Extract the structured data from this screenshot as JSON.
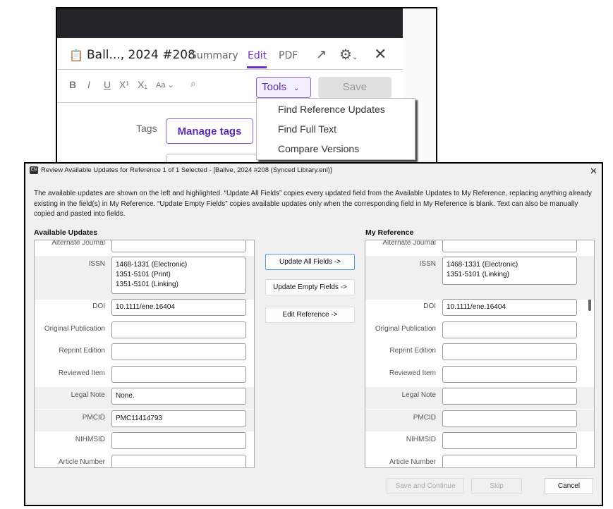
{
  "editor": {
    "title": "Ball..., 2024 #208",
    "tabs": [
      "Summary",
      "Edit",
      "PDF"
    ],
    "toolbar": [
      "B",
      "I",
      "U",
      "X¹",
      "X₁",
      "Aa ⌄"
    ],
    "tools_label": "Tools",
    "save_label": "Save",
    "tools_menu": [
      "Find Reference Updates",
      "Find Full Text",
      "Compare Versions"
    ],
    "tags_label": "Tags",
    "manage_tags_label": "Manage tags"
  },
  "dialog": {
    "title": "Review Available Updates for Reference 1 of 1 Selected - [Ballve, 2024 #208 (Synced Library.enl)]",
    "icon_text": "EN",
    "description": "The available updates are shown on the left and highlighted. “Update All Fields” copies every updated field from the Available Updates to My Reference, replacing anything already existing in the field(s) in My Reference. “Update Empty Fields” copies available updates only when the corresponding field in My Reference is blank. Text can also be manually copied and pasted into fields.",
    "available_title": "Available Updates",
    "my_title": "My Reference",
    "available_fields": [
      {
        "label": "Alternate Journal",
        "value": ""
      },
      {
        "label": "ISSN",
        "value": "1468-1331 (Electronic)\n1351-5101 (Print)\n1351-5101 (Linking)"
      },
      {
        "label": "DOI",
        "value": "10.1111/ene.16404"
      },
      {
        "label": "Original Publication",
        "value": ""
      },
      {
        "label": "Reprint Edition",
        "value": ""
      },
      {
        "label": "Reviewed Item",
        "value": ""
      },
      {
        "label": "Legal Note",
        "value": "None."
      },
      {
        "label": "PMCID",
        "value": "PMC11414793"
      },
      {
        "label": "NIHMSID",
        "value": ""
      },
      {
        "label": "Article Number",
        "value": ""
      }
    ],
    "my_fields": [
      {
        "label": "Alternate Journal",
        "value": ""
      },
      {
        "label": "ISSN",
        "value": "1468-1331 (Electronic)\n1351-5101 (Linking)"
      },
      {
        "label": "DOI",
        "value": "10.1111/ene.16404"
      },
      {
        "label": "Original Publication",
        "value": ""
      },
      {
        "label": "Reprint Edition",
        "value": ""
      },
      {
        "label": "Reviewed Item",
        "value": ""
      },
      {
        "label": "Legal Note",
        "value": ""
      },
      {
        "label": "PMCID",
        "value": ""
      },
      {
        "label": "NIHMSID",
        "value": ""
      },
      {
        "label": "Article Number",
        "value": ""
      }
    ],
    "update_all_label": "Update All Fields ->",
    "update_empty_label": "Update Empty Fields ->",
    "edit_reference_label": "Edit Reference ->",
    "save_continue_label": "Save and Continue",
    "skip_label": "Skip",
    "cancel_label": "Cancel"
  }
}
